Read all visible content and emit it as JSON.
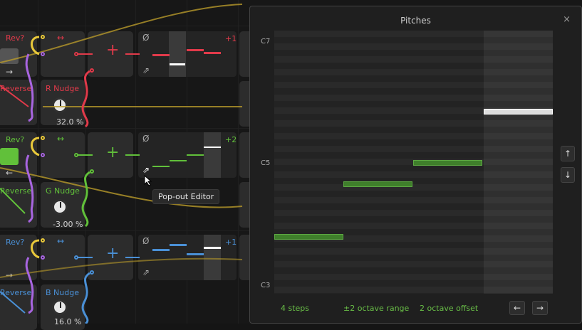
{
  "colors": {
    "red": "#e13a4a",
    "green": "#61c03a",
    "blue": "#4a90d6",
    "yellow": "#e8c83a",
    "purple": "#a865e0",
    "orange": "#e87a2a"
  },
  "lanes": [
    {
      "rev_label": "Rev?",
      "reverse_label": "Reverse",
      "nudge_label": "R Nudge",
      "nudge_value": "32.0 %",
      "step_label": "+1",
      "dir_icon": "arrow-right-icon"
    },
    {
      "rev_label": "Rev?",
      "reverse_label": "Reverse",
      "nudge_label": "G Nudge",
      "nudge_value": "-3.00 %",
      "step_label": "+2",
      "dir_icon": "arrow-left-icon"
    },
    {
      "rev_label": "Rev?",
      "reverse_label": "Reverse",
      "nudge_label": "B Nudge",
      "nudge_value": "16.0 %",
      "step_label": "+1",
      "dir_icon": "arrow-right-icon"
    }
  ],
  "tooltip": "Pop-out Editor",
  "panel": {
    "title": "Pitches",
    "octave_labels": [
      "C7",
      "C5",
      "C3"
    ],
    "status": {
      "steps": "4 steps",
      "range": "±2 octave range",
      "offset": "2 octave offset"
    },
    "buttons": {
      "up": "↑",
      "down": "↓",
      "left": "←",
      "right": "→",
      "close": "×"
    }
  }
}
